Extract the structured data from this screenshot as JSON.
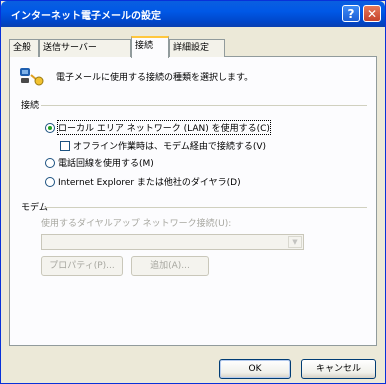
{
  "window": {
    "title": "インターネット電子メールの設定"
  },
  "titlebar_buttons": {
    "help": "?",
    "close": "✕"
  },
  "tabs": [
    {
      "label": "全般",
      "active": false
    },
    {
      "label": "送信サーバー",
      "active": false
    },
    {
      "label": "接続",
      "active": true
    },
    {
      "label": "詳細設定",
      "active": false
    }
  ],
  "connection": {
    "description": "電子メールに使用する接続の種類を選択します。",
    "group_label": "接続",
    "options": [
      {
        "label": "ローカル エリア ネットワーク (LAN) を使用する(C)",
        "checked": true
      },
      {
        "label": "電話回線を使用する(M)",
        "checked": false
      },
      {
        "label": "Internet Explorer または他社のダイヤラ(D)",
        "checked": false
      }
    ],
    "offline_checkbox": {
      "label": "オフライン作業時は、モデム経由で接続する(V)",
      "checked": false
    }
  },
  "modem": {
    "group_label": "モデム",
    "dialup_label": "使用するダイヤルアップ ネットワーク接続(U):",
    "dialup_value": "",
    "properties_button": "プロパティ(P)...",
    "add_button": "追加(A)..."
  },
  "dialog_buttons": {
    "ok": "OK",
    "cancel": "キャンセル"
  },
  "colors": {
    "titlebar": "#0058e6",
    "dialog_bg": "#ece9d8",
    "panel_bg": "#fcfcfe",
    "close": "#c5422a"
  }
}
